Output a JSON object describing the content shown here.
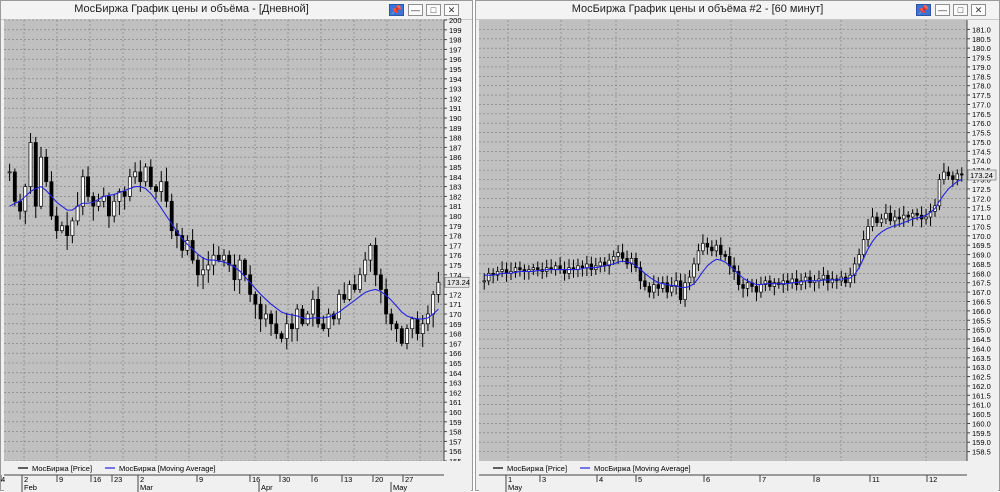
{
  "colors": {
    "plot_bg": "#c0c0c0",
    "grid": "#7a7a7a",
    "candle": "#000000",
    "ma": "#2323e0",
    "last_box": "#e6e6e6"
  },
  "windows": [
    {
      "title": "МосБиржа График цены и объёма - [Дневной]",
      "buttons": [
        "pin-icon",
        "minimize-icon",
        "maximize-icon",
        "close-icon"
      ],
      "legend": [
        {
          "label": "МосБиржа [Price]",
          "color": "#000000"
        },
        {
          "label": "МосБиржа [Moving Average]",
          "color": "#2323e0"
        }
      ],
      "last_value_label": "173.24",
      "x_ticks": [
        "2",
        "9",
        "16",
        "23",
        "2",
        "9",
        "16",
        "30",
        "6",
        "13",
        "20",
        "27",
        "4"
      ],
      "month_labels": [
        "Feb",
        "Mar",
        "Apr",
        "May"
      ]
    },
    {
      "title": "МосБиржа График цены и объёма #2 - [60 минут]",
      "buttons": [
        "pin-icon",
        "minimize-icon",
        "maximize-icon",
        "close-icon"
      ],
      "legend": [
        {
          "label": "МосБиржа [Price]",
          "color": "#000000"
        },
        {
          "label": "МосБиржа [Moving Average]",
          "color": "#2323e0"
        }
      ],
      "last_value_label": "173.24",
      "x_ticks": [
        "1",
        "3",
        "4",
        "5",
        "6",
        "7",
        "8",
        "11",
        "12"
      ],
      "month_labels": [
        "May"
      ]
    }
  ],
  "chart_data": [
    {
      "type": "candlestick",
      "title": "МосБиржа График цены и объёма - [Дневной]",
      "ylim": [
        155,
        200
      ],
      "y_ticks": [
        "155",
        "156",
        "157",
        "158",
        "159",
        "160",
        "161",
        "162",
        "163",
        "164",
        "165",
        "166",
        "167",
        "168",
        "169",
        "170",
        "171",
        "172",
        "173",
        "174",
        "175",
        "176",
        "177",
        "178",
        "179",
        "180",
        "181",
        "182",
        "183",
        "184",
        "185",
        "186",
        "187",
        "188",
        "189",
        "190",
        "191",
        "192",
        "193",
        "194",
        "195",
        "196",
        "197",
        "198",
        "199",
        "200"
      ],
      "series": [
        {
          "name": "МосБиржа [Price]",
          "close": [
            184.5,
            181.5,
            180.5,
            183.0,
            187.5,
            181.0,
            186.0,
            183.5,
            180.0,
            178.5,
            179.0,
            178.0,
            179.5,
            181.0,
            184.0,
            182.0,
            181.0,
            181.5,
            182.0,
            180.0,
            181.5,
            182.5,
            182.0,
            184.0,
            184.5,
            183.5,
            185.0,
            183.0,
            182.5,
            183.5,
            181.5,
            178.5,
            178.0,
            176.5,
            177.5,
            175.5,
            174.0,
            174.5,
            175.0,
            176.0,
            175.5,
            176.0,
            175.0,
            173.5,
            175.5,
            174.0,
            172.0,
            171.0,
            169.5,
            170.0,
            169.0,
            168.0,
            167.5,
            169.0,
            168.5,
            170.5,
            169.0,
            170.0,
            171.5,
            169.0,
            168.5,
            170.0,
            169.5,
            172.0,
            171.5,
            173.0,
            172.5,
            174.0,
            175.5,
            177.0,
            174.0,
            172.5,
            170.0,
            169.0,
            168.5,
            167.0,
            168.5,
            169.5,
            168.0,
            169.0,
            170.0,
            172.0,
            173.24
          ]
        },
        {
          "name": "МосБиржа [Moving Average]",
          "values": [
            181.0,
            181.3,
            181.5,
            182.0,
            182.5,
            182.8,
            183.0,
            182.6,
            182.0,
            181.4,
            181.0,
            180.6,
            180.6,
            181.0,
            181.3,
            181.3,
            181.4,
            181.7,
            182.0,
            182.1,
            182.2,
            182.4,
            182.6,
            182.8,
            183.0,
            183.0,
            182.8,
            182.3,
            181.6,
            180.8,
            180.0,
            179.2,
            178.4,
            177.7,
            177.1,
            176.6,
            176.1,
            175.7,
            175.5,
            175.5,
            175.4,
            175.3,
            175.1,
            174.8,
            174.4,
            173.8,
            173.2,
            172.6,
            172.0,
            171.5,
            171.0,
            170.6,
            170.2,
            170.0,
            169.9,
            169.8,
            169.6,
            169.5,
            169.6,
            169.6,
            169.6,
            169.7,
            169.9,
            170.2,
            170.6,
            171.0,
            171.4,
            171.8,
            172.2,
            172.4,
            172.5,
            172.3,
            171.9,
            171.4,
            170.8,
            170.2,
            169.8,
            169.6,
            169.5,
            169.5,
            169.6,
            170.0,
            170.5
          ]
        }
      ]
    },
    {
      "type": "candlestick",
      "title": "МосБиржа График цены и объёма #2 - [60 минут]",
      "ylim": [
        158,
        181.5
      ],
      "y_ticks": [
        "158.5",
        "159.0",
        "159.5",
        "160.0",
        "160.5",
        "161.0",
        "161.5",
        "162.0",
        "162.5",
        "163.0",
        "163.5",
        "164.0",
        "164.5",
        "165.0",
        "165.5",
        "166.0",
        "166.5",
        "167.0",
        "167.5",
        "168.0",
        "168.5",
        "169.0",
        "169.5",
        "170.0",
        "170.5",
        "171.0",
        "171.5",
        "172.0",
        "172.5",
        "173.0",
        "173.5",
        "174.0",
        "174.5",
        "175.0",
        "175.5",
        "176.0",
        "176.5",
        "177.0",
        "177.5",
        "178.0",
        "178.5",
        "179.0",
        "179.5",
        "180.0",
        "180.5",
        "181.0"
      ],
      "series": [
        {
          "name": "МосБиржа [Price]",
          "close": [
            167.6,
            168.0,
            167.9,
            168.1,
            168.2,
            168.0,
            168.1,
            168.3,
            168.2,
            168.1,
            168.2,
            168.3,
            168.2,
            168.1,
            168.3,
            168.2,
            168.4,
            168.2,
            168.0,
            168.3,
            168.2,
            168.4,
            168.3,
            168.5,
            168.2,
            168.4,
            168.6,
            168.4,
            168.7,
            168.9,
            169.1,
            168.8,
            168.5,
            168.8,
            168.3,
            167.6,
            167.3,
            167.0,
            167.4,
            167.2,
            167.5,
            167.0,
            167.3,
            167.6,
            166.6,
            167.5,
            167.8,
            168.5,
            169.2,
            169.6,
            169.4,
            169.2,
            169.5,
            169.0,
            168.9,
            168.4,
            168.1,
            167.4,
            167.2,
            167.5,
            167.3,
            167.0,
            167.4,
            167.6,
            167.3,
            167.5,
            167.4,
            167.6,
            167.5,
            167.7,
            167.4,
            167.6,
            167.8,
            167.5,
            167.6,
            167.7,
            167.9,
            167.5,
            167.7,
            167.6,
            167.8,
            167.5,
            167.9,
            168.5,
            169.0,
            169.8,
            170.5,
            171.0,
            170.7,
            170.9,
            171.2,
            170.8,
            171.0,
            170.9,
            171.1,
            171.0,
            171.2,
            171.1,
            170.9,
            171.0,
            171.3,
            171.6,
            173.0,
            173.4,
            173.2,
            173.0,
            173.3,
            173.24
          ]
        },
        {
          "name": "МосБиржа [Moving Average]",
          "values": [
            167.9,
            167.9,
            167.9,
            167.95,
            168.0,
            168.0,
            168.0,
            168.05,
            168.1,
            168.1,
            168.1,
            168.1,
            168.15,
            168.15,
            168.2,
            168.2,
            168.2,
            168.2,
            168.2,
            168.2,
            168.2,
            168.2,
            168.25,
            168.3,
            168.3,
            168.3,
            168.35,
            168.4,
            168.45,
            168.5,
            168.6,
            168.65,
            168.6,
            168.55,
            168.4,
            168.2,
            168.0,
            167.8,
            167.65,
            167.5,
            167.45,
            167.4,
            167.35,
            167.35,
            167.25,
            167.25,
            167.3,
            167.45,
            167.75,
            168.1,
            168.4,
            168.6,
            168.75,
            168.7,
            168.6,
            168.4,
            168.2,
            167.95,
            167.75,
            167.6,
            167.5,
            167.4,
            167.4,
            167.45,
            167.45,
            167.45,
            167.45,
            167.45,
            167.45,
            167.5,
            167.5,
            167.55,
            167.6,
            167.6,
            167.6,
            167.6,
            167.65,
            167.65,
            167.65,
            167.65,
            167.7,
            167.7,
            167.75,
            167.95,
            168.3,
            168.8,
            169.3,
            169.7,
            170.0,
            170.2,
            170.35,
            170.45,
            170.55,
            170.6,
            170.7,
            170.8,
            170.9,
            170.95,
            171.0,
            171.1,
            171.25,
            171.45,
            171.85,
            172.2,
            172.5,
            172.7,
            172.9,
            173.0
          ]
        }
      ]
    }
  ]
}
